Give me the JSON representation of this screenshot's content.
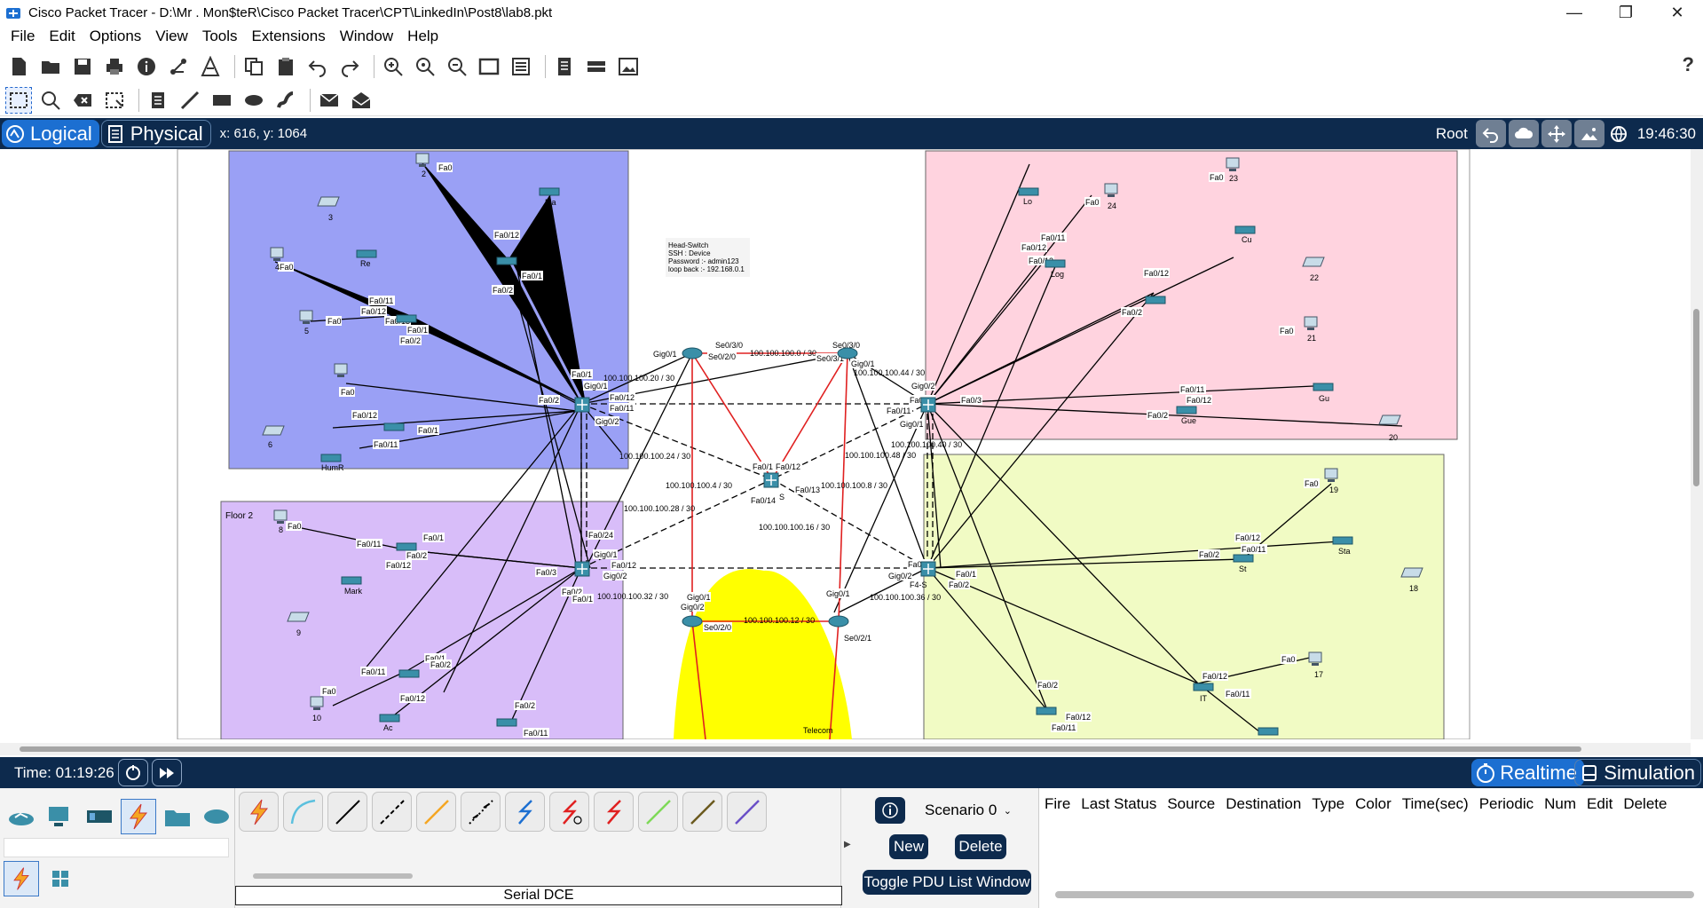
{
  "window": {
    "title": "Cisco Packet Tracer - D:\\Mr . Mon$teR\\Cisco Packet Tracer\\CPT\\LinkedIn\\Post8\\lab8.pkt",
    "minimize": "—",
    "maximize": "❐",
    "close": "✕"
  },
  "menu": [
    "File",
    "Edit",
    "Options",
    "View",
    "Tools",
    "Extensions",
    "Window",
    "Help"
  ],
  "toolbar": {
    "help": "?"
  },
  "modebar": {
    "logical": "Logical",
    "physical": "Physical",
    "coords": "x: 616, y: 1064",
    "root": "Root",
    "clock": "19:46:30"
  },
  "workspace": {
    "note": [
      "Head-Switch",
      "SSH : Device",
      "Password :- admin123",
      "loop back :- 192.168.0.1"
    ],
    "floor2": "Floor 2",
    "telecom": "Telecom",
    "links": {
      "l1": "100.100.100.0 / 30",
      "l2": "100.100.100.20 / 30",
      "l3": "100.100.100.44 / 30",
      "l4": "100.100.100.24 / 30",
      "l5": "100.100.100.4 / 30",
      "l6": "100.100.100.8 / 30",
      "l7": "100.100.100.48 / 30",
      "l8": "100.100.100.40 / 30",
      "l9": "100.100.100.28 / 30",
      "l10": "100.100.100.16 / 30",
      "l11": "100.100.100.32 / 30",
      "l12": "100.100.100.12 / 30",
      "l13": "100.100.100.36 / 30"
    },
    "devices": {
      "d2": "2",
      "d3": "3",
      "d4": "4",
      "d5": "5",
      "d6": "6",
      "d8": "8",
      "d9": "9",
      "d10": "10",
      "d17": "17",
      "d18": "18",
      "d19": "19",
      "d20": "20",
      "d21": "21",
      "d22": "22",
      "d23": "23",
      "d24": "24",
      "ma": "Ma",
      "re": "Re",
      "humr": "HumR",
      "mark": "Mark",
      "ac": "Ac",
      "st": "St",
      "sta": "Sta",
      "it": "IT",
      "gue": "Gue",
      "gu": "Gu",
      "cu": "Cu",
      "log": "Log",
      "lo": "Lo",
      "f4s": "F4-S",
      "s": "S"
    },
    "ports": {
      "fa0": "Fa0",
      "fa012": "Fa0/12",
      "fa011": "Fa0/11",
      "fa013": "Fa0/13",
      "fa01": "Fa0/1",
      "fa02": "Fa0/2",
      "fa03": "Fa0/3",
      "fa024": "Fa0/24",
      "fa014": "Fa0/14",
      "gig01": "Gig0/1",
      "gig02": "Gig0/2",
      "se030": "Se0/3/0",
      "se020": "Se0/2/0",
      "se031": "Se0/3/1",
      "se021": "Se0/2/1"
    }
  },
  "timebar": {
    "time": "Time: 01:19:26",
    "realtime": "Realtime",
    "simulation": "Simulation"
  },
  "bottom": {
    "conn_caption": "Serial DCE",
    "scenario": "Scenario 0",
    "new": "New",
    "delete": "Delete",
    "toggle": "Toggle PDU List Window",
    "pdu_columns": [
      "Fire",
      "Last Status",
      "Source",
      "Destination",
      "Type",
      "Color",
      "Time(sec)",
      "Periodic",
      "Num",
      "Edit",
      "Delete"
    ]
  },
  "colors": {
    "dark_navy": "#0d2a4d",
    "accent_blue": "#1c6fd1",
    "zone_blue": "#9aa0f5",
    "zone_lilac": "#d8bdf9",
    "zone_pink": "#ffd3df",
    "zone_lime": "#f1fbc4",
    "telecom_yellow": "#ffff00",
    "serial_red": "#e02020"
  }
}
